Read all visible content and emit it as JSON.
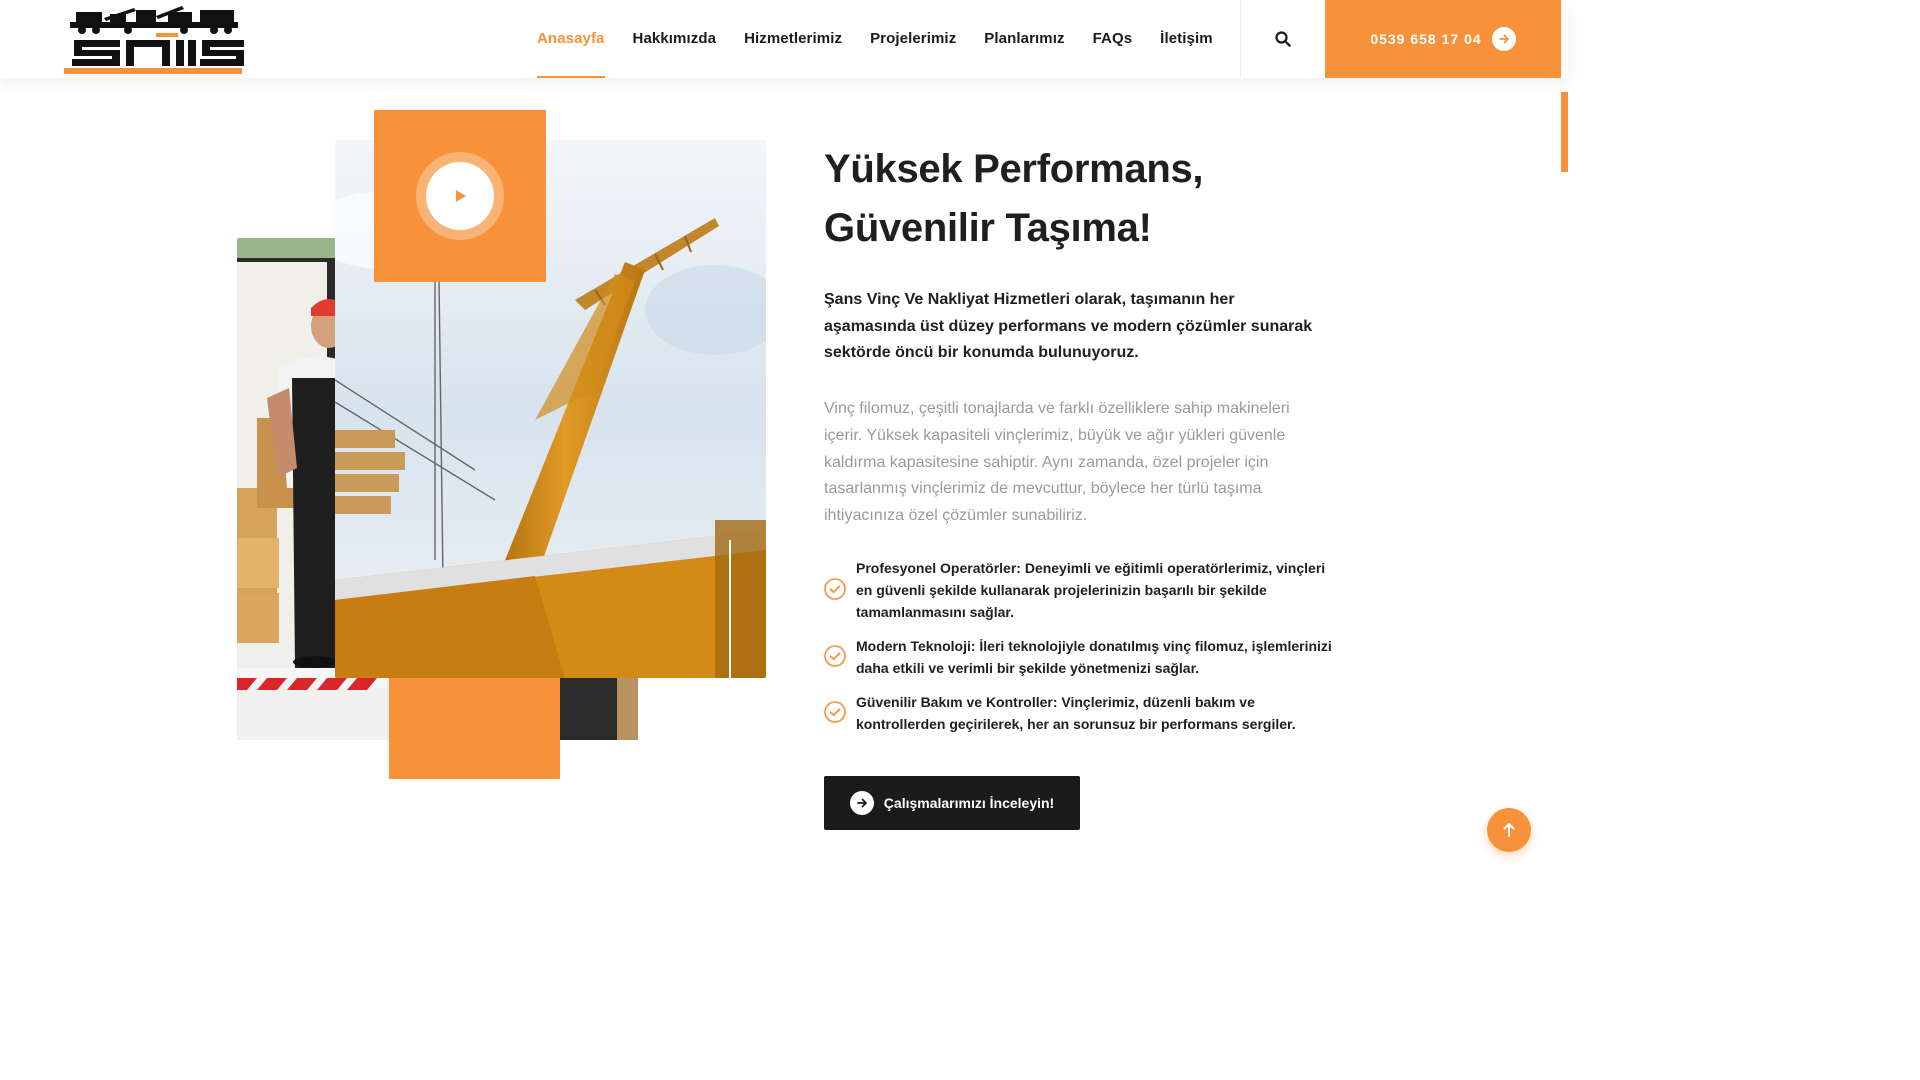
{
  "brand": {
    "logo_text": "şans",
    "accent": "#f7923a",
    "dark": "#1b1b1b"
  },
  "nav": {
    "items": [
      {
        "label": "Anasayfa",
        "active": true
      },
      {
        "label": "Hakkımızda"
      },
      {
        "label": "Hizmetlerimiz"
      },
      {
        "label": "Projelerimiz"
      },
      {
        "label": "Planlarımız"
      },
      {
        "label": "FAQs"
      },
      {
        "label": "İletişim"
      }
    ],
    "search_icon": "search-icon"
  },
  "phone": {
    "label": "0539 658 17 04",
    "icon": "arrow-right-icon"
  },
  "hero": {
    "heading_line1": "Yüksek Performans,",
    "heading_line2": "Güvenilir Taşıma!",
    "lead": "Şans Vinç Ve Nakliyat Hizmetleri olarak, taşımanın her aşamasında üst düzey performans ve modern çözümler sunarak sektörde öncü bir konumda bulunuyoruz.",
    "paragraph": "Vinç filomuz, çeşitli tonajlarda ve farklı özelliklere sahip makineleri içerir. Yüksek kapasiteli vinçlerimiz, büyük ve ağır yükleri güvenle kaldırma kapasitesine sahiptir. Aynı zamanda, özel projeler için tasarlanmış vinçlerimiz de mevcuttur, böylece her türlü taşıma ihtiyacınıza özel çözümler sunabiliriz.",
    "features": [
      "Profesyonel Operatörler: Deneyimli ve eğitimli operatörlerimiz, vinçleri en güvenli şekilde kullanarak projelerinizin başarılı bir şekilde tamamlanmasını sağlar.",
      "Modern Teknoloji: İleri teknolojiyle donatılmış vinç filomuz, işlemlerinizi daha etkili ve verimli bir şekilde yönetmenizi sağlar.",
      "Güvenilir Bakım ve Kontroller: Vinçlerimiz, düzenli bakım ve kontrollerden geçirilerek, her an sorunsuz bir performans sergiler."
    ],
    "cta_label": "Çalışmalarımızı İnceleyin!"
  },
  "icons": {
    "play": "play-icon",
    "check": "check-circle-icon",
    "to_top": "arrow-up-icon"
  }
}
